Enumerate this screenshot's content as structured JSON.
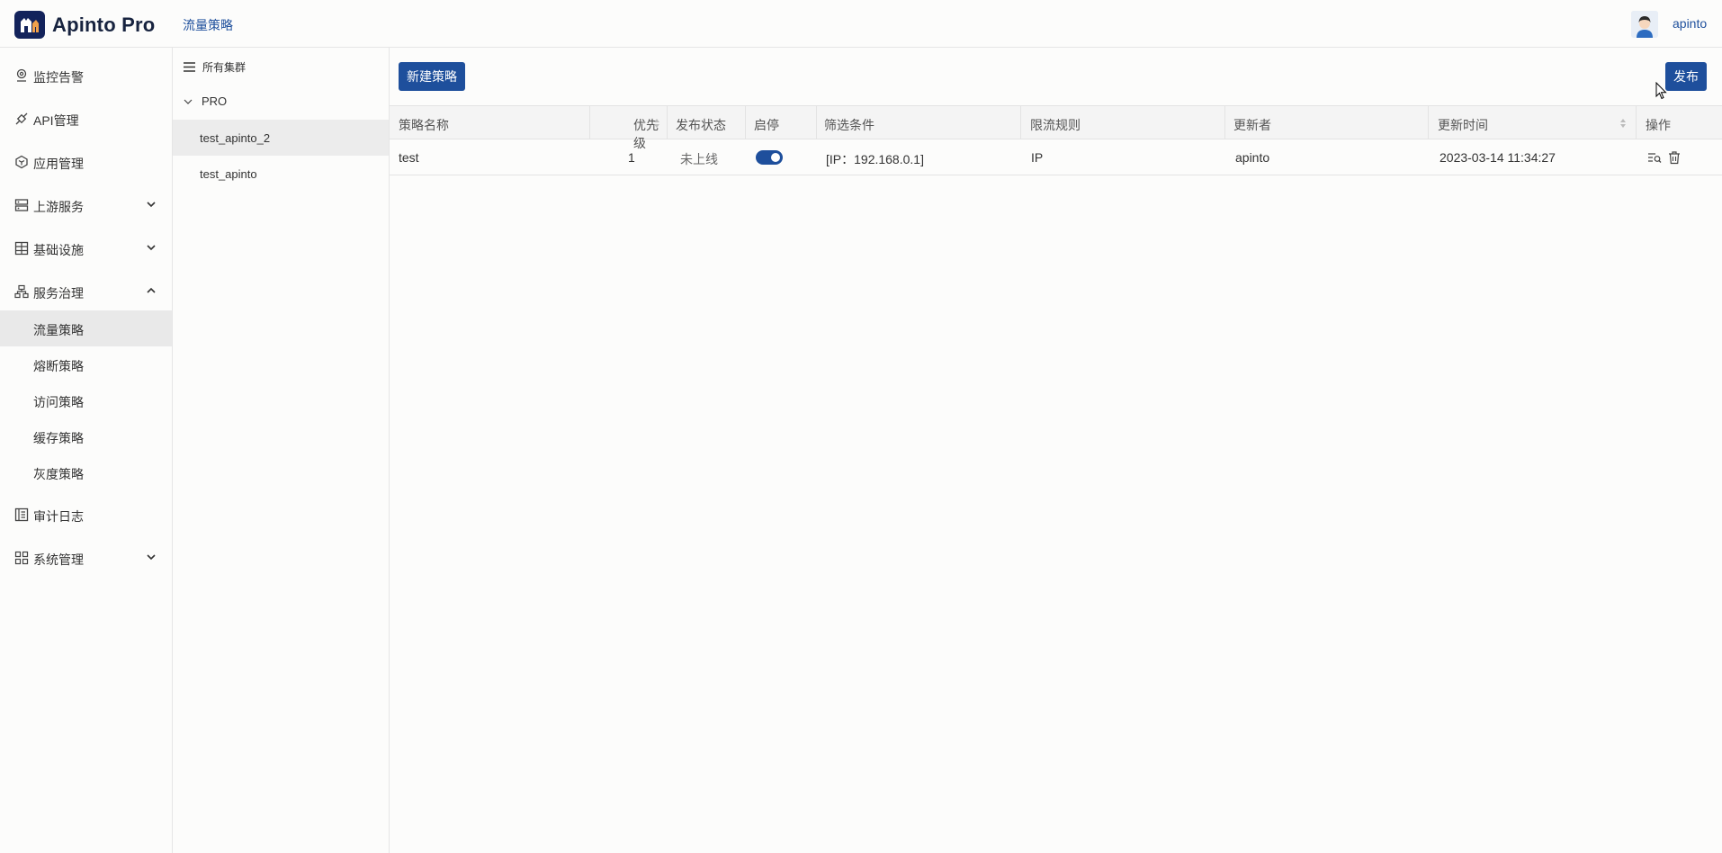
{
  "header": {
    "app_name": "Apinto Pro",
    "breadcrumb": "流量策略",
    "username": "apinto"
  },
  "sidebar": {
    "items": [
      {
        "label": "监控告警",
        "icon": "monitor-pin-icon"
      },
      {
        "label": "API管理",
        "icon": "api-plug-icon"
      },
      {
        "label": "应用管理",
        "icon": "app-cube-icon"
      },
      {
        "label": "上游服务",
        "icon": "upstream-server-icon",
        "expandable": true
      },
      {
        "label": "基础设施",
        "icon": "infrastructure-icon",
        "expandable": true
      },
      {
        "label": "服务治理",
        "icon": "service-governance-icon",
        "expanded": true
      },
      {
        "label": "审计日志",
        "icon": "audit-log-icon"
      },
      {
        "label": "系统管理",
        "icon": "system-grid-icon",
        "expandable": true
      }
    ],
    "sub_items": [
      "流量策略",
      "熔断策略",
      "访问策略",
      "缓存策略",
      "灰度策略"
    ],
    "active_sub": "流量策略"
  },
  "clusters": {
    "all_label": "所有集群",
    "group": "PRO",
    "items": [
      "test_apinto_2",
      "test_apinto"
    ],
    "active": "test_apinto_2"
  },
  "toolbar": {
    "new_label": "新建策略",
    "publish_label": "发布"
  },
  "table": {
    "columns": [
      "策略名称",
      "优先级",
      "发布状态",
      "启停",
      "筛选条件",
      "限流规则",
      "更新者",
      "更新时间",
      "操作"
    ],
    "rows": [
      {
        "name": "test",
        "priority": "1",
        "status": "未上线",
        "enabled": true,
        "filter": "[IP：192.168.0.1]",
        "rule": "IP",
        "updater": "apinto",
        "updated_at": "2023-03-14 11:34:27"
      }
    ]
  },
  "colors": {
    "primary": "#1e4f9c",
    "logo_bg": "#13235b",
    "active_bg": "#e9e9e9"
  }
}
